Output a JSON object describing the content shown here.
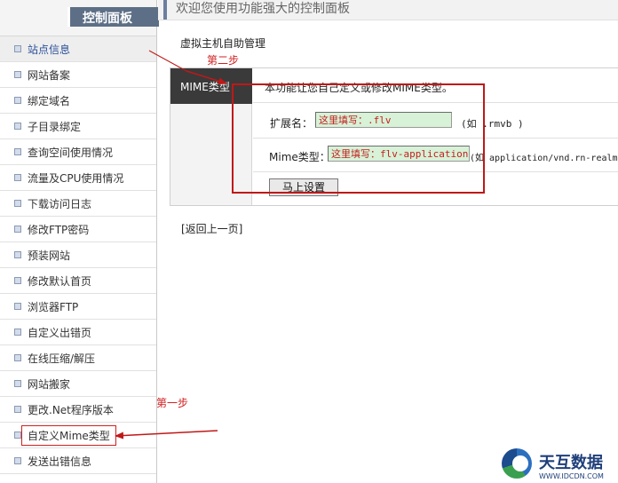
{
  "sidebar": {
    "title": "控制面板",
    "items": [
      {
        "label": "站点信息"
      },
      {
        "label": "网站备案"
      },
      {
        "label": "绑定域名"
      },
      {
        "label": "子目录绑定"
      },
      {
        "label": "查询空间使用情况"
      },
      {
        "label": "流量及CPU使用情况"
      },
      {
        "label": "下载访问日志"
      },
      {
        "label": "修改FTP密码"
      },
      {
        "label": "预装网站"
      },
      {
        "label": "修改默认首页"
      },
      {
        "label": "浏览器FTP"
      },
      {
        "label": "自定义出错页"
      },
      {
        "label": "在线压缩/解压"
      },
      {
        "label": "网站搬家"
      },
      {
        "label": "更改.Net程序版本"
      },
      {
        "label": "自定义Mime类型"
      },
      {
        "label": "发送出错信息"
      }
    ]
  },
  "header": {
    "welcome": "欢迎您使用功能强大的控制面板"
  },
  "main": {
    "section_title": "虚拟主机自助管理",
    "tag_label": "MIME类型：",
    "description": "本功能让您自己定义或修改MIME类型。",
    "extension": {
      "label": "扩展名：",
      "value": "这里填写：.flv",
      "hint": "(如 .rmvb )"
    },
    "mime": {
      "label": "Mime类型：",
      "value": "这里填写：flv-application/octet-stream",
      "hint": "(如 application/vnd.rn-realmedia)"
    },
    "submit_label": "马上设置",
    "back_link": "[返回上一页]"
  },
  "annotations": {
    "step1": "第一步",
    "step2": "第二步",
    "color": "#d12020"
  },
  "logo": {
    "name": "天互数据",
    "url_text": "WWW.IDCDN.COM"
  }
}
